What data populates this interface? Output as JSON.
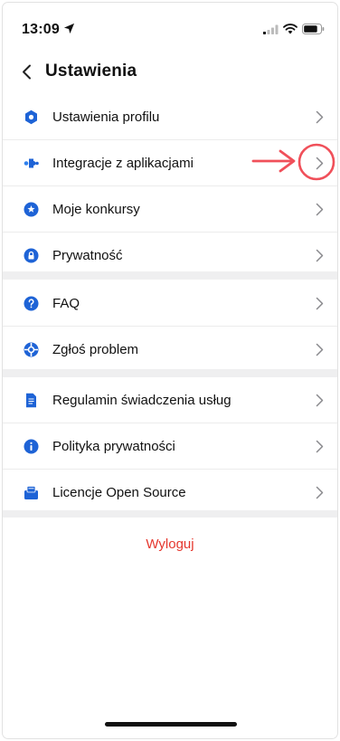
{
  "status_bar": {
    "time": "13:09"
  },
  "nav": {
    "title": "Ustawienia"
  },
  "sections": [
    [
      {
        "label": "Ustawienia profilu",
        "icon": "gear-icon"
      },
      {
        "label": "Integracje z aplikacjami",
        "icon": "puzzle-icon"
      },
      {
        "label": "Moje konkursy",
        "icon": "star-badge-icon"
      },
      {
        "label": "Prywatność",
        "icon": "lock-icon"
      }
    ],
    [
      {
        "label": "FAQ",
        "icon": "question-icon"
      },
      {
        "label": "Zgłoś problem",
        "icon": "lifebuoy-icon"
      }
    ],
    [
      {
        "label": "Regulamin świadczenia usług",
        "icon": "document-icon"
      },
      {
        "label": "Polityka prywatności",
        "icon": "info-icon"
      },
      {
        "label": "Licencje Open Source",
        "icon": "license-icon"
      }
    ]
  ],
  "logout_label": "Wyloguj",
  "colors": {
    "accent": "#1e63d6",
    "logout": "#e5372e",
    "annotation": "#f0505a",
    "divider": "#efeff0"
  }
}
